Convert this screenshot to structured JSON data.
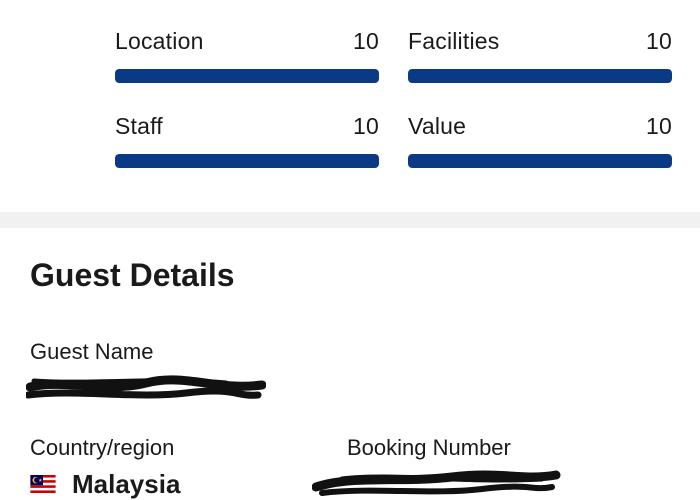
{
  "scores": [
    {
      "label": "Location",
      "value": "10",
      "fill": 1.0
    },
    {
      "label": "Facilities",
      "value": "10",
      "fill": 1.0
    },
    {
      "label": "Staff",
      "value": "10",
      "fill": 1.0
    },
    {
      "label": "Value",
      "value": "10",
      "fill": 1.0
    }
  ],
  "colors": {
    "bar_fill": "#0b3a85",
    "section_divider": "#f1f1f1",
    "text": "#1a1a1a"
  },
  "guest_details": {
    "title": "Guest Details",
    "guest_name_label": "Guest Name",
    "country_label": "Country/region",
    "country_value": "Malaysia",
    "country_flag_icon": "malaysia-flag-icon",
    "booking_number_label": "Booking Number"
  }
}
